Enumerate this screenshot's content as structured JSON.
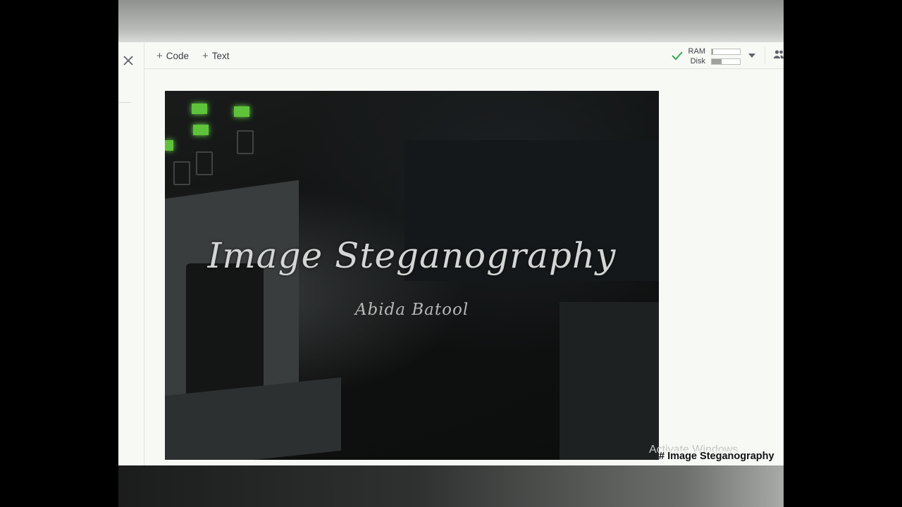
{
  "toolbar": {
    "add_code_label": "Code",
    "add_text_label": "Text",
    "ram_label": "RAM",
    "disk_label": "Disk",
    "ram_usage": 0.05,
    "disk_usage": 0.35
  },
  "icons": {
    "close": "close-icon",
    "plus": "plus-icon",
    "check": "check-icon",
    "caret": "caret-down-icon",
    "share": "people-icon"
  },
  "cell": {
    "image_title": "Image Steganography",
    "image_author": "Abida Batool",
    "markdown_heading": "# Image Steganography"
  },
  "os_watermark": "Activate Windows",
  "colors": {
    "check": "#34a853",
    "led": "#5ec23a"
  }
}
